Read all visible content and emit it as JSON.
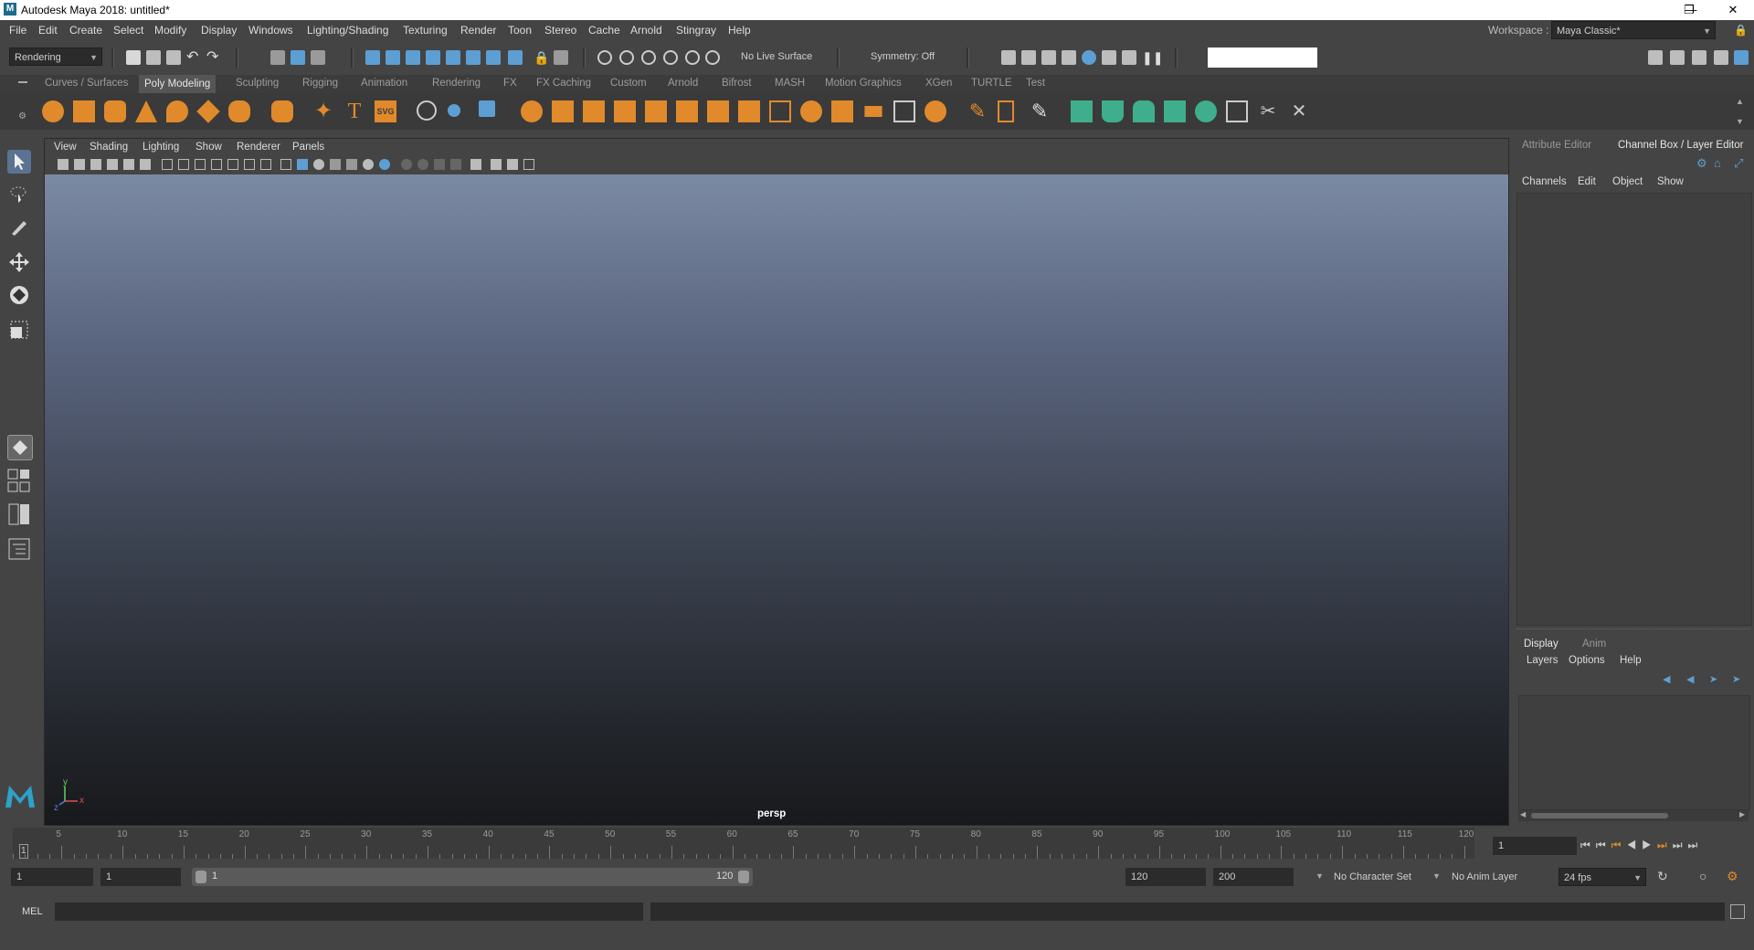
{
  "titlebar": {
    "title": "Autodesk Maya 2018: untitled*",
    "logo": "M"
  },
  "menus": [
    "File",
    "Edit",
    "Create",
    "Select",
    "Modify",
    "Display",
    "Windows",
    "Lighting/Shading",
    "Texturing",
    "Render",
    "Toon",
    "Stereo",
    "Cache",
    "Arnold",
    "Stingray",
    "Help"
  ],
  "workspace": {
    "label": "Workspace :",
    "value": "Maya Classic*"
  },
  "statusline": {
    "menuset": "Rendering",
    "live_surface": "No Live Surface",
    "symmetry": "Symmetry: Off"
  },
  "shelf_tabs": [
    "Curves / Surfaces",
    "Poly Modeling",
    "Sculpting",
    "Rigging",
    "Animation",
    "Rendering",
    "FX",
    "FX Caching",
    "Custom",
    "Arnold",
    "Bifrost",
    "MASH",
    "Motion Graphics",
    "XGen",
    "TURTLE",
    "Test"
  ],
  "shelf_active": "Poly Modeling",
  "shelf_svg_label": "SVG",
  "shelf_type_label": "T",
  "viewport": {
    "menus": [
      "View",
      "Shading",
      "Lighting",
      "Show",
      "Renderer",
      "Panels"
    ],
    "camera": "persp",
    "axis_y": "y",
    "axis_x": "x",
    "axis_z": "z"
  },
  "right_panel": {
    "tabs": [
      "Attribute Editor",
      "Channel Box / Layer Editor"
    ],
    "channel_menus": [
      "Channels",
      "Edit",
      "Object",
      "Show"
    ],
    "layer_tabs": [
      "Display",
      "Anim"
    ],
    "layer_menus": [
      "Layers",
      "Options",
      "Help"
    ]
  },
  "timeline": {
    "ticks": [
      5,
      10,
      15,
      20,
      25,
      30,
      35,
      40,
      45,
      50,
      55,
      60,
      65,
      70,
      75,
      80,
      85,
      90,
      95,
      100,
      105,
      110,
      115,
      120
    ],
    "start_marker": "1",
    "current_frame": "1"
  },
  "range": {
    "start": "1",
    "anim_start": "1",
    "slider_left": "1",
    "slider_right": "120",
    "anim_end": "120",
    "end": "200",
    "character_set": "No Character Set",
    "anim_layer": "No Anim Layer",
    "fps": "24 fps"
  },
  "cmdline": {
    "label": "MEL"
  },
  "colors": {
    "accent_orange": "#e08a2c",
    "accent_blue": "#5d9fd3",
    "shelf_green": "#3fae8c"
  }
}
